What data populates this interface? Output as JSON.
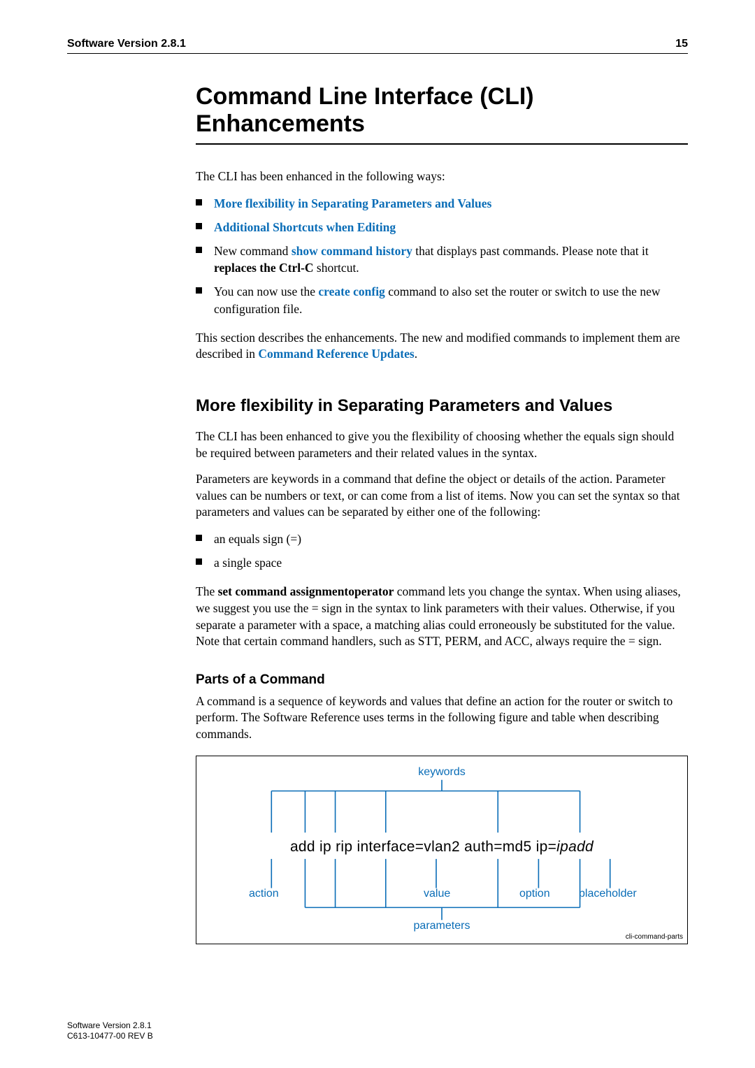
{
  "header": {
    "left": "Software Version 2.8.1",
    "pageNumber": "15"
  },
  "title_line1": "Command Line Interface (CLI)",
  "title_line2": "Enhancements",
  "intro": "The CLI has been enhanced in the following ways:",
  "topLinks": {
    "l1": "More flexibility in Separating Parameters and Values",
    "l2": "Additional Shortcuts when Editing",
    "bullet3_pre": "New command ",
    "bullet3_link": "show command history",
    "bullet3_mid": " that displays past commands. Please note that it ",
    "bullet3_bold": "replaces the Ctrl-C",
    "bullet3_post": " shortcut.",
    "bullet4_pre": "You can now use the ",
    "bullet4_link": "create config",
    "bullet4_post": " command to also set the router or switch to use the new configuration file."
  },
  "bridge_pre": "This section describes the enhancements. The new and modified commands to implement them are described in ",
  "bridge_link": "Command Reference Updates",
  "bridge_post": ".",
  "h2_text": "More flexibility in Separating Parameters and Values",
  "p_flex1": "The CLI has been enhanced to give you the flexibility of choosing whether the equals sign should be required between parameters and their related values in the syntax.",
  "p_flex2": "Parameters are keywords in a command that define the object or details of the action. Parameter values can be numbers or text, or can come from a list of items. Now you can set the syntax so that parameters and values can be separated by either one of the following:",
  "sepList": {
    "i1": "an equals sign (=)",
    "i2": "a single space"
  },
  "pset_pre": "The ",
  "pset_bold": "set command assignmentoperator",
  "pset_post": " command lets you change the syntax. When using aliases, we suggest you use the = sign in the syntax to link parameters with their values. Otherwise, if you separate a parameter with a space, a matching alias could erroneously be substituted for the value. Note that certain command handlers, such as STT, PERM, and ACC, always require the = sign.",
  "h3_text": "Parts of a Command",
  "p_parts": "A command is a sequence of keywords and values that define an action for the router or switch to perform. The Software Reference uses terms in the following figure and table when describing commands.",
  "figure": {
    "keywords": "keywords",
    "action": "action",
    "value": "value",
    "option": "option",
    "placeholder": "placeholder",
    "parameters": "parameters",
    "cmd_plain_pre": "add ip rip interface=vlan2 auth=md5 ip=",
    "cmd_ital": "ipadd",
    "ref": "cli-command-parts"
  },
  "footer": {
    "line1": "Software Version 2.8.1",
    "line2": "C613-10477-00 REV B"
  }
}
